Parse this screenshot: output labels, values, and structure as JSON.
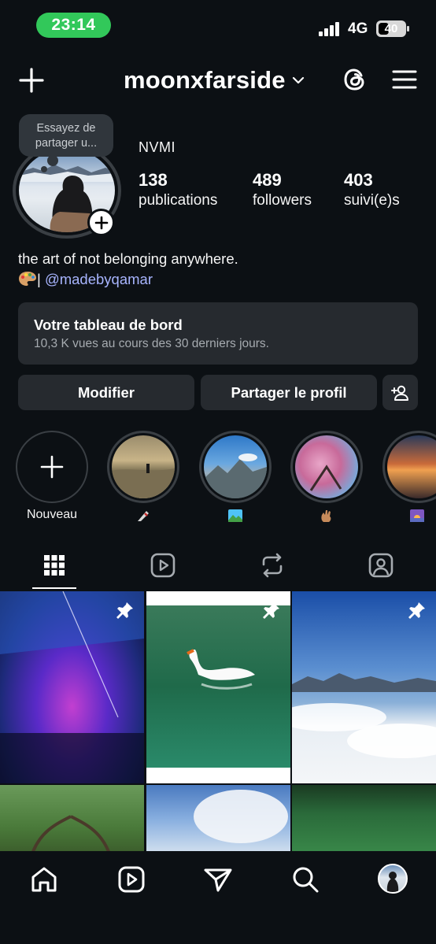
{
  "status_bar": {
    "time": "23:14",
    "network": "4G",
    "battery": "40",
    "battery_level": 0.4
  },
  "header": {
    "username": "moonxfarside"
  },
  "profile": {
    "note": "Essayez de partager u...",
    "display_name": "NVMI",
    "stats": [
      {
        "value": "138",
        "label": "publications"
      },
      {
        "value": "489",
        "label": "followers"
      },
      {
        "value": "403",
        "label": "suivi(e)s"
      }
    ],
    "bio_line1": "the art of not belonging anywhere.",
    "bio_separator": "|",
    "bio_mention": "@madebyqamar"
  },
  "dashboard": {
    "title": "Votre tableau de bord",
    "subtitle": "10,3 K vues au cours des 30 derniers jours."
  },
  "buttons": {
    "edit": "Modifier",
    "share": "Partager le profil"
  },
  "highlights": [
    {
      "label": "Nouveau"
    },
    {
      "label": ""
    },
    {
      "label": ""
    },
    {
      "label": ""
    },
    {
      "label": ""
    }
  ],
  "tabs": [
    "grid-icon",
    "reels-icon",
    "reposts-icon",
    "tagged-icon"
  ],
  "nav": [
    "home-icon",
    "reels-icon",
    "send-icon",
    "search-icon",
    "profile-avatar"
  ],
  "colors": {
    "background": "#0c1014",
    "card": "#262a2f",
    "link": "#a8b5ff",
    "clock_pill": "#32c85a"
  }
}
